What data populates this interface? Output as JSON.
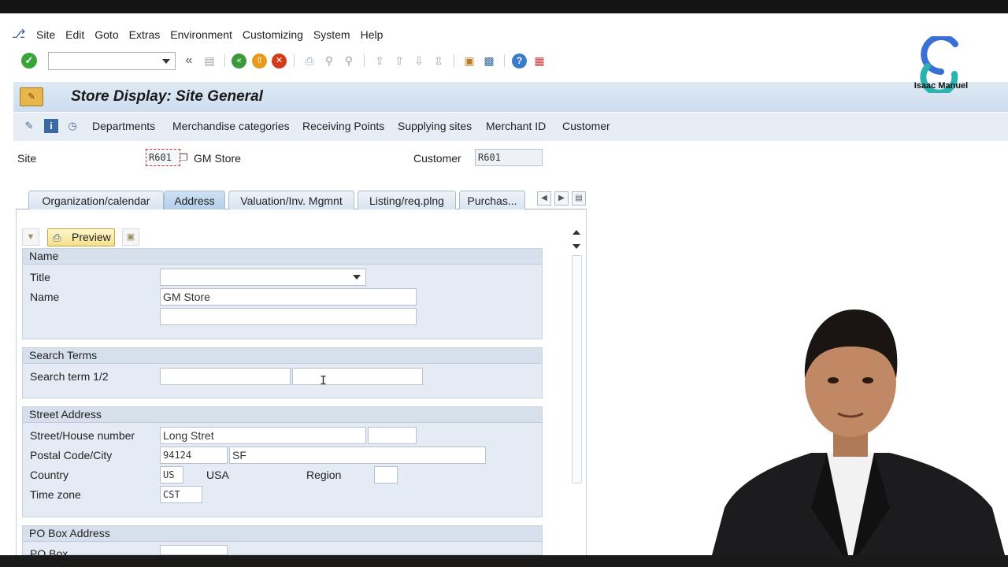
{
  "menubar": {
    "items": [
      "Site",
      "Edit",
      "Goto",
      "Extras",
      "Environment",
      "Customizing",
      "System",
      "Help"
    ]
  },
  "toolbar": {
    "command_field_value": ""
  },
  "screen": {
    "title": "Store Display: Site General"
  },
  "app_toolbar": {
    "links": [
      "Departments",
      "Merchandise categories",
      "Receiving Points",
      "Supplying sites",
      "Merchant ID",
      "Customer"
    ]
  },
  "header": {
    "site_label": "Site",
    "site_value": "R601",
    "site_name": "GM Store",
    "customer_label": "Customer",
    "customer_value": "R601"
  },
  "tabs": {
    "items": [
      "Organization/calendar",
      "Address",
      "Valuation/Inv. Mgmnt",
      "Listing/req.plng",
      "Purchas..."
    ],
    "active": "Address"
  },
  "subtoolbar": {
    "preview_label": "Preview"
  },
  "name_group": {
    "heading": "Name",
    "title_label": "Title",
    "title_value": "",
    "name_label": "Name",
    "name_value": "GM Store",
    "name2_value": ""
  },
  "search_group": {
    "heading": "Search Terms",
    "label": "Search term 1/2",
    "term1": "",
    "term2": ""
  },
  "street_group": {
    "heading": "Street Address",
    "street_label": "Street/House number",
    "street_value": "Long Stret",
    "house_value": "",
    "postal_label": "Postal Code/City",
    "postal_value": "94124",
    "city_value": "SF",
    "country_label": "Country",
    "country_code": "US",
    "country_name": "USA",
    "region_label": "Region",
    "region_value": "",
    "timezone_label": "Time zone",
    "timezone_value": "CST"
  },
  "pobox_group": {
    "heading": "PO Box Address",
    "pobox_label": "PO Box"
  },
  "branding": {
    "logo_text": "Isaac Manuel",
    "accent_blue": "#3b6fd8",
    "accent_teal": "#2bb3b0"
  },
  "colors": {
    "title_bar": "#cdddee",
    "group_bg": "#e4ebf4",
    "preview_button": "#f5e08a",
    "ok_green": "#3aa43a"
  }
}
